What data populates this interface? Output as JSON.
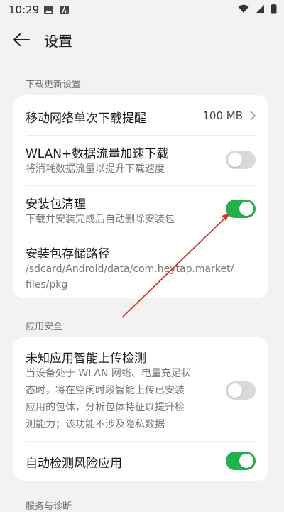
{
  "status_bar": {
    "time": "10:29",
    "icons": [
      "gallery-icon",
      "font-icon",
      "wifi-icon",
      "signal-icon",
      "battery-icon"
    ]
  },
  "header": {
    "title": "设置",
    "back_icon": "arrow-left-icon"
  },
  "sections": {
    "download": {
      "title": "下载更新设置",
      "mobile_reminder": {
        "title": "移动网络单次下载提醒",
        "value": "100 MB"
      },
      "wlan_boost": {
        "title": "WLAN+数据流量加速下载",
        "subtitle": "将消耗数据流量以提升下载速度",
        "enabled": false
      },
      "package_cleanup": {
        "title": "安装包清理",
        "subtitle": "下载并安装完成后自动删除安装包",
        "enabled": true
      },
      "storage_path": {
        "title": "安装包存储路径",
        "path_line1": "/sdcard/Android/data/com.heytap.market/",
        "path_line2": "files/pkg"
      }
    },
    "app_security": {
      "title": "应用安全",
      "smart_upload": {
        "title": "未知应用智能上传检测",
        "sub1": "当设备处于 WLAN 网络、电量充足状",
        "sub2": "态时，将在空闲时段智能上传已安装",
        "sub3": "应用的包体，分析包体特征以提升检",
        "sub4": "测能力；该功能不涉及隐私数据",
        "enabled": false
      },
      "auto_detect": {
        "title": "自动检测风险应用",
        "enabled": true
      }
    },
    "next": {
      "title": "服务与诊断"
    }
  },
  "colors": {
    "accent": "#1fb34a",
    "background": "#f2f2f2",
    "card": "#ffffff",
    "annotation": "#e03030"
  }
}
